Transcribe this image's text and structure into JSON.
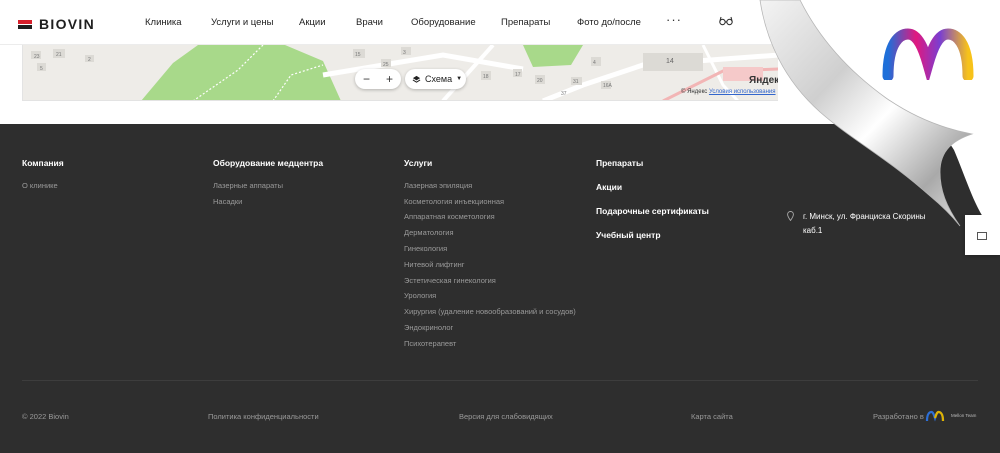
{
  "header": {
    "logo_text": "BIOVIN",
    "nav": [
      "Клиника",
      "Услуги и цены",
      "Акции",
      "Врачи",
      "Оборудование",
      "Препараты",
      "Фото до/после"
    ],
    "more": "···"
  },
  "map": {
    "zoom_minus": "−",
    "zoom_plus": "+",
    "scheme_label": "Схема",
    "caret": "▼",
    "copyright": "© Яндекс",
    "terms": "Условия использования",
    "yandex": "Яндекс",
    "labels": [
      "23",
      "21",
      "14",
      "4",
      "18",
      "16A",
      "17",
      "20",
      "2",
      "5",
      "25",
      "31",
      "37",
      "3",
      "15"
    ]
  },
  "footer": {
    "col1": {
      "title": "Компания",
      "links": [
        "О клинике"
      ]
    },
    "col2": {
      "title": "Оборудование медцентра",
      "links": [
        "Лазерные аппараты",
        "Насадки"
      ]
    },
    "col3": {
      "title": "Услуги",
      "links": [
        "Лазерная эпиляция",
        "Косметология инъекционная",
        "Аппаратная косметология",
        "Дерматология",
        "Гинекология",
        "Нитевой лифтинг",
        "Эстетическая гинекология",
        "Урология",
        "Хирургия (удаление новообразований и сосудов)",
        "Эндокринолог",
        "Психотерапевт"
      ]
    },
    "col4": {
      "titles": [
        "Препараты",
        "Акции",
        "Подарочные сертификаты",
        "Учебный центр"
      ]
    },
    "address_line1": "г. Минск, ул. Франциска Скорины",
    "address_line2": "каб.1",
    "bottom": {
      "copyright": "© 2022 Biovin",
      "privacy": "Политика конфиденциальности",
      "accessibility": "Версия для слабовидящих",
      "sitemap": "Карта сайта",
      "developed": "Разработано в",
      "developer_name": "Mellon Team"
    }
  },
  "colors": {
    "footer_bg": "#2e2e2e",
    "brand_red": "#d71f2b",
    "map_green": "#a8d98a"
  },
  "icons": [
    "glasses-icon",
    "layers-icon",
    "pin-icon",
    "mail-icon",
    "brand-logo"
  ]
}
